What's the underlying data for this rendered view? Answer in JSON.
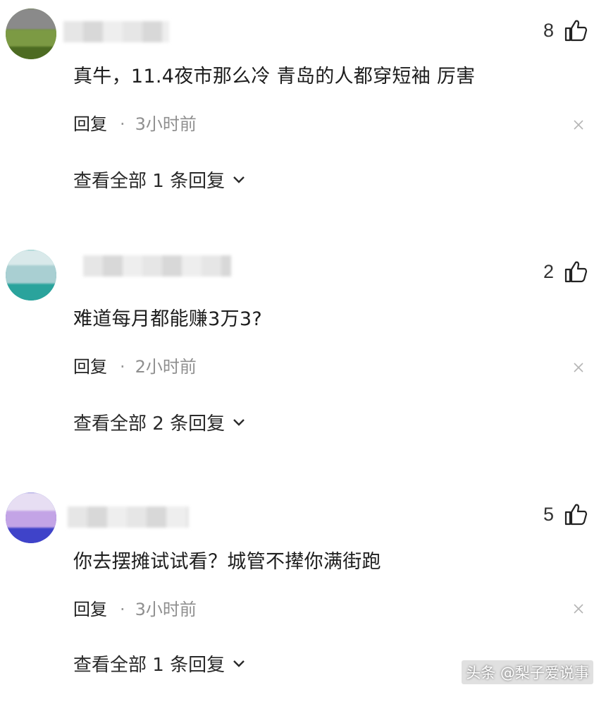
{
  "comments": [
    {
      "like_count": "8",
      "text": "真牛，11.4夜市那么冷 青岛的人都穿短袖 厉害",
      "reply_label": "回复",
      "separator": "·",
      "time": "3小时前",
      "view_replies": "查看全部 1 条回复",
      "avatar_color": "#5d7a2e"
    },
    {
      "like_count": "2",
      "text": "难道每月都能赚3万3?",
      "reply_label": "回复",
      "separator": "·",
      "time": "2小时前",
      "view_replies": "查看全部 2 条回复",
      "avatar_color": "#2aa39c"
    },
    {
      "like_count": "5",
      "text": "你去摆摊试试看？城管不撵你满街跑",
      "reply_label": "回复",
      "separator": "·",
      "time": "3小时前",
      "view_replies": "查看全部 1 条回复",
      "avatar_color": "#3f43c9"
    }
  ],
  "watermark": "头条 @梨子爱说事",
  "icons": {
    "like": "thumbs-up-icon",
    "close": "close-icon",
    "expand": "chevron-down-icon"
  }
}
